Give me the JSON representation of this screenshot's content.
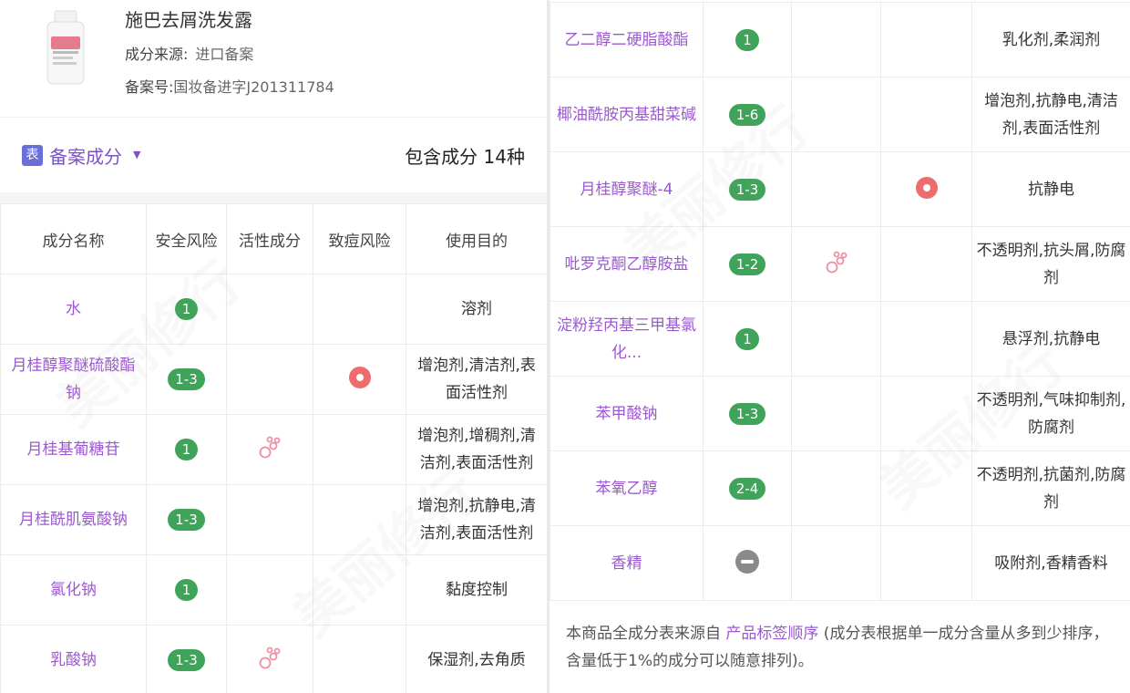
{
  "product": {
    "name": "施巴去屑洗发露",
    "source_label": "成分来源:",
    "source_value": "进口备案",
    "reg_label": "备案号:",
    "reg_value": "国妆备进字J201311784"
  },
  "section": {
    "tag": "表",
    "title": "备案成分",
    "count": "包含成分 14种"
  },
  "table": {
    "headers": [
      "成分名称",
      "安全风险",
      "活性成分",
      "致痘风险",
      "使用目的"
    ]
  },
  "ingredients_left": [
    {
      "name": "水",
      "risk": "1",
      "active": false,
      "acne": false,
      "purpose": "溶剂"
    },
    {
      "name": "月桂醇聚醚硫酸酯钠",
      "risk": "1-3",
      "active": false,
      "acne": true,
      "purpose": "增泡剂,清洁剂,表面活性剂"
    },
    {
      "name": "月桂基葡糖苷",
      "risk": "1",
      "active": true,
      "acne": false,
      "purpose": "增泡剂,增稠剂,清洁剂,表面活性剂"
    },
    {
      "name": "月桂酰肌氨酸钠",
      "risk": "1-3",
      "active": false,
      "acne": false,
      "purpose": "增泡剂,抗静电,清洁剂,表面活性剂"
    },
    {
      "name": "氯化钠",
      "risk": "1",
      "active": false,
      "acne": false,
      "purpose": "黏度控制"
    },
    {
      "name": "乳酸钠",
      "risk": "1-3",
      "active": true,
      "acne": false,
      "purpose": "保湿剂,去角质"
    }
  ],
  "ingredients_right": [
    {
      "name": "乙二醇二硬脂酸酯",
      "risk": "1",
      "active": false,
      "acne": false,
      "purpose": "乳化剂,柔润剂"
    },
    {
      "name": "椰油酰胺丙基甜菜碱",
      "risk": "1-6",
      "active": false,
      "acne": false,
      "purpose": "增泡剂,抗静电,清洁剂,表面活性剂"
    },
    {
      "name": "月桂醇聚醚-4",
      "risk": "1-3",
      "active": false,
      "acne": true,
      "purpose": "抗静电"
    },
    {
      "name": "吡罗克酮乙醇胺盐",
      "risk": "1-2",
      "active": true,
      "acne": false,
      "purpose": "不透明剂,抗头屑,防腐剂"
    },
    {
      "name": "淀粉羟丙基三甲基氯化...",
      "risk": "1",
      "active": false,
      "acne": false,
      "purpose": "悬浮剂,抗静电"
    },
    {
      "name": "苯甲酸钠",
      "risk": "1-3",
      "active": false,
      "acne": false,
      "purpose": "不透明剂,气味抑制剂,防腐剂"
    },
    {
      "name": "苯氧乙醇",
      "risk": "2-4",
      "active": false,
      "acne": false,
      "purpose": "不透明剂,抗菌剂,防腐剂"
    },
    {
      "name": "香精",
      "risk": "unknown",
      "active": false,
      "acne": false,
      "purpose": "吸附剂,香精香料"
    }
  ],
  "footnote": {
    "prefix": "本商品全成分表来源自 ",
    "link": "产品标签顺序",
    "suffix": " (成分表根据单一成分含量从多到少排序，含量低于1%的成分可以随意排列)。"
  },
  "watermark": "美丽修行",
  "colors": {
    "accent": "#9b59d0",
    "risk_green": "#3fa45a",
    "acne_red": "#ee6c6c",
    "unknown_grey": "#8a8a8a",
    "tag_blue": "#6a6fd8"
  }
}
